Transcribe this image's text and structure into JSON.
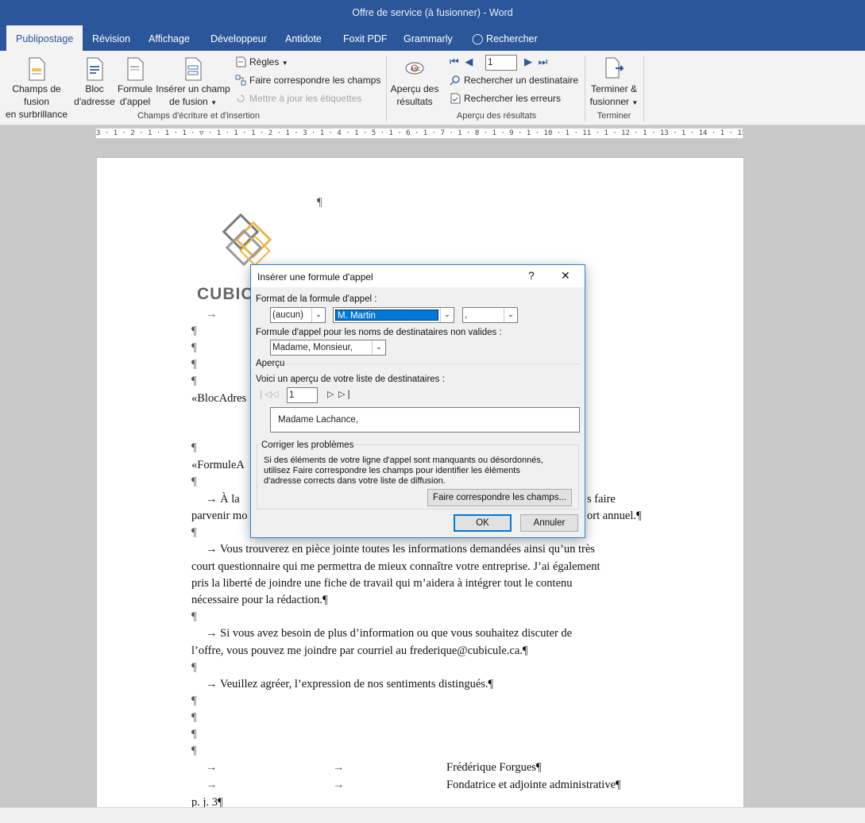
{
  "window": {
    "title": "Offre de service (à fusionner)  -  Word"
  },
  "tabs": [
    {
      "label": "Publipostage",
      "active": true
    },
    {
      "label": "Révision"
    },
    {
      "label": "Affichage"
    },
    {
      "label": "Développeur"
    },
    {
      "label": "Antidote"
    },
    {
      "label": "Foxit PDF"
    },
    {
      "label": "Grammarly"
    },
    {
      "label": "Rechercher"
    }
  ],
  "ribbon": {
    "highlight_fields": "Champs de fusion",
    "highlight_fields2": "en surbrillance",
    "address_block": "Bloc",
    "address_block2": "d'adresse",
    "greeting_line": "Formule",
    "greeting_line2": "d'appel",
    "insert_field": "Insérer un champ",
    "insert_field2": "de fusion",
    "rules": "Règles",
    "match_fields": "Faire correspondre les champs",
    "update_labels": "Mettre à jour les étiquettes",
    "group_fields": "Champs d'écriture et d'insertion",
    "preview_results": "Aperçu des",
    "preview_results2": "résultats",
    "record_number": "1",
    "find_recipient": "Rechercher un destinataire",
    "check_errors": "Rechercher les erreurs",
    "group_preview": "Aperçu des résultats",
    "finish_merge": "Terminer &",
    "finish_merge2": "fusionner",
    "group_finish": "Terminer"
  },
  "ruler": {
    "numbers": "3 · 1 · 2 · 1 · 1 · 1 · ▽ · 1 · 1 · 1 · 2 · 1 · 3 · 1 · 4 · 1 · 5 · 1 · 6 · 1 · 7 · 1 · 8 · 1 · 9 · 1 · 10 · 1 · 11 · 1 · 12 · 1 · 13 · 1 · 14 · 1 · 15 · 1 · 16 · 1 · 17 · 1 · 18"
  },
  "document": {
    "logo_text": "CUBIC",
    "pilcrow": "¶",
    "address_block_field": "«BlocAdres",
    "greeting_field": "«FormuleA",
    "p1_a": "→    À la",
    "p1_a_end": "s faire",
    "p1_b": "parvenir mo",
    "p1_b_end": "ort annuel.¶",
    "p2_a": "→    Vous trouverez en pièce jointe toutes les informations demandées ainsi qu’un très",
    "p2_b": "court questionnaire qui me permettra de mieux connaître votre entreprise. J’ai également",
    "p2_c": "pris la liberté de joindre une fiche de travail qui m’aidera à intégrer tout le contenu",
    "p2_d": "nécessaire pour la rédaction.¶",
    "p3_a": "→    Si vous avez besoin de plus d’information ou que vous souhaitez discuter de",
    "p3_b": "l’offre, vous pouvez me joindre par courriel au frederique@cubicule.ca.¶",
    "p4": "→    Veuillez agréer, l’expression de nos sentiments distingués.¶",
    "sig_arrow": "→",
    "sig_name": "Frédérique Forgues¶",
    "sig_title": "Fondatrice et adjointe administrative¶",
    "enclosure": "p. j. 3¶"
  },
  "dialog": {
    "title": "Insérer une formule d'appel",
    "help": "?",
    "close": "✕",
    "format_label": "Format de la formule d'appel :",
    "opt1": "(aucun)",
    "opt2": "M. Martin",
    "opt3": ",",
    "invalid_label": "Formule d'appel pour les noms de destinataires non valides :",
    "invalid_value": "Madame, Monsieur,",
    "preview_section": "Aperçu",
    "preview_label": "Voici un aperçu de votre liste de destinataires :",
    "preview_record": "1",
    "preview_text": "Madame Lachance,",
    "fix_section": "Corriger les problèmes",
    "fix_text1": "Si des éléments de votre ligne d'appel sont manquants ou désordonnés,",
    "fix_text2": "utilisez Faire correspondre les champs pour identifier les éléments",
    "fix_text3": "d'adresse corrects dans votre liste de diffusion.",
    "match_button": "Faire correspondre les champs...",
    "ok": "OK",
    "cancel": "Annuler"
  }
}
